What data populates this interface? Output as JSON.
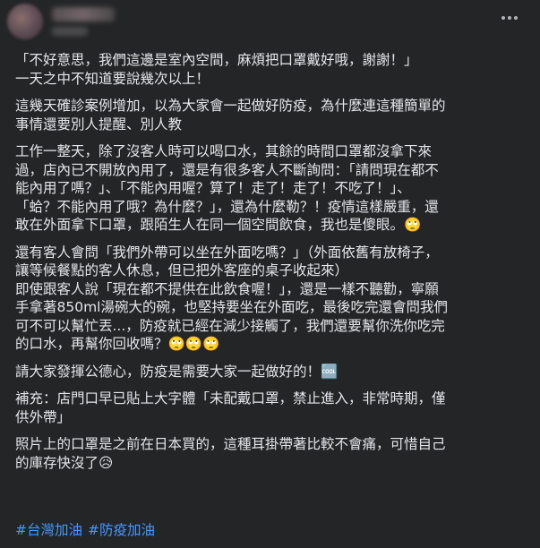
{
  "post": {
    "more_icon": "more-horizontal-icon",
    "paragraphs": [
      [
        "「不好意思，我們這邊是室內空間，麻煩把口罩戴好哦，謝謝！」",
        "一天之中不知道要說幾次以上！"
      ],
      [
        "這幾天確診案例增加，以為大家會一起做好防疫，為什麼連這種簡單的",
        "事情還要別人提醒、別人教"
      ],
      [
        "工作一整天，除了沒客人時可以喝口水，其餘的時間口罩都沒拿下來",
        "過，店內已不開放內用了，還是有很多客人不斷詢問：「請問現在都不",
        "能內用了嗎？」、「不能內用喔？算了！走了！走了！不吃了！」、",
        "「蛤？不能內用了哦？為什麼？」，還為什麼勒？！疫情這樣嚴重，還",
        "敢在外面拿下口罩，跟陌生人在同一個空間飲食，我也是傻眼。🙄"
      ],
      [
        "還有客人會問「我們外帶可以坐在外面吃嗎？」（外面依舊有放椅子，",
        "讓等候餐點的客人休息，但已把外客座的桌子收起來）",
        "即使跟客人說「現在都不提供在此飲食喔！」，還是一樣不聽勸，寧願",
        "手拿著850ml湯碗大的碗，也堅持要坐在外面吃，最後吃完還會問我們",
        "可不可以幫忙丟...，防疫就已經在減少接觸了，我們還要幫你洗你吃完",
        "的口水，再幫你回收嗎？🙄🙄🙄"
      ],
      [
        "請大家發揮公德心，防疫是需要大家一起做好的！🆒"
      ],
      [
        "補充：店門口早已貼上大字體「未配戴口罩，禁止進入，非常時期，僅",
        "供外帶」"
      ],
      [
        "照片上的口罩是之前在日本買的，這種耳掛帶著比較不會痛，可惜自己",
        "的庫存快沒了😥"
      ]
    ],
    "hashtags": [
      "#台灣加油",
      "#防疫加油"
    ]
  }
}
